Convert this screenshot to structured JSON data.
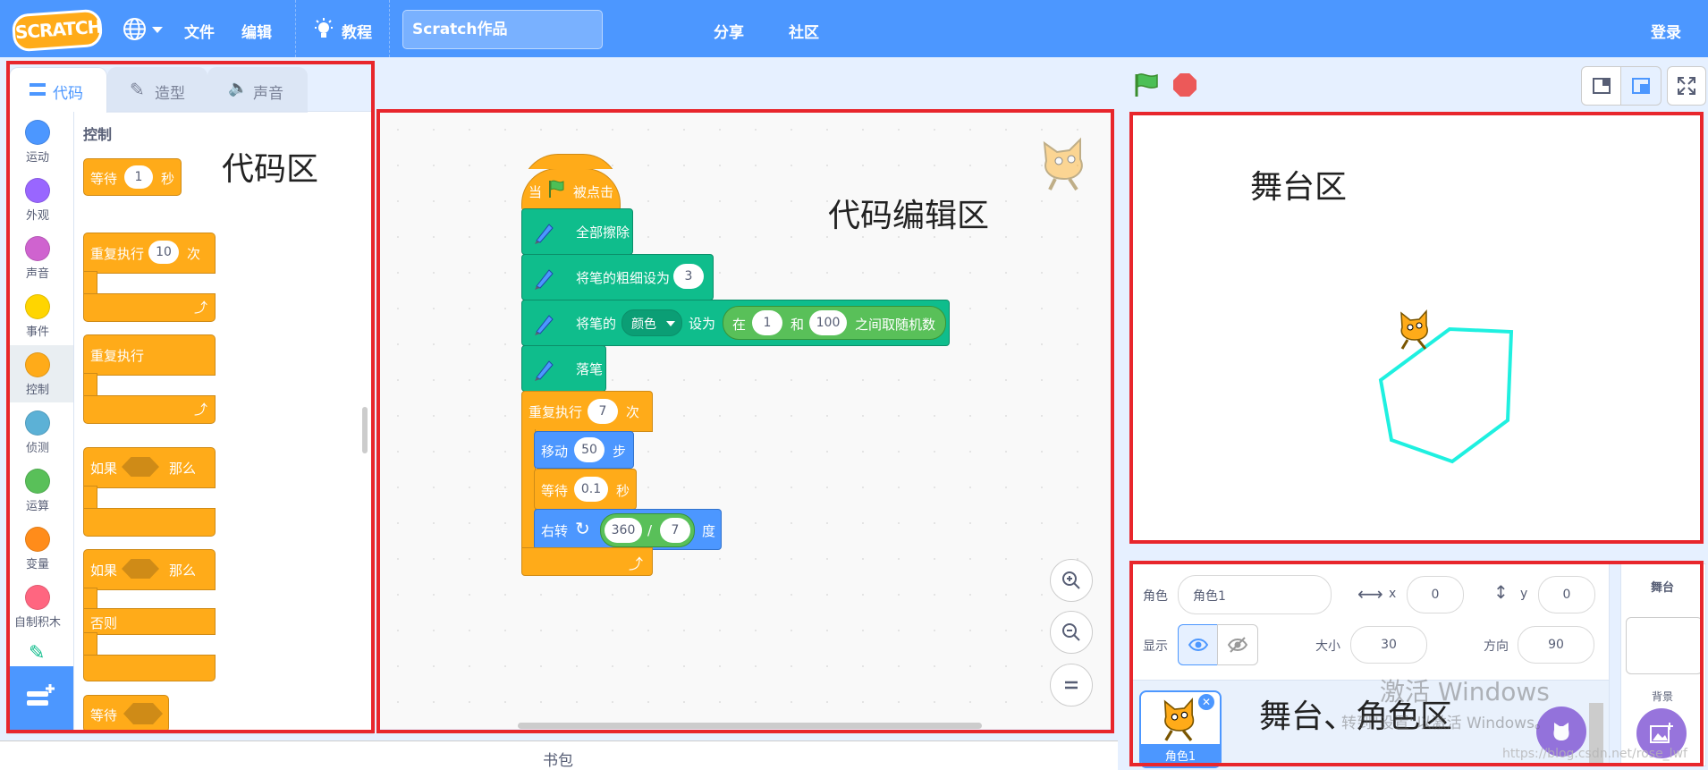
{
  "menu": {
    "logo": "SCRATCH",
    "file": "文件",
    "edit": "编辑",
    "tutorials": "教程",
    "project_title": "Scratch作品",
    "share": "分享",
    "community": "社区",
    "login": "登录"
  },
  "tabs": {
    "code": "代码",
    "costumes": "造型",
    "sounds": "声音"
  },
  "categories": [
    {
      "label": "运动",
      "color": "#4c97ff"
    },
    {
      "label": "外观",
      "color": "#9966ff"
    },
    {
      "label": "声音",
      "color": "#cf63cf"
    },
    {
      "label": "事件",
      "color": "#ffd500"
    },
    {
      "label": "控制",
      "color": "#ffab19"
    },
    {
      "label": "侦测",
      "color": "#5cb1d6"
    },
    {
      "label": "运算",
      "color": "#59c059"
    },
    {
      "label": "变量",
      "color": "#ff8c1a"
    },
    {
      "label": "自制积木",
      "color": "#ff6680"
    }
  ],
  "palette": {
    "heading": "控制",
    "wait": "等待",
    "wait_value": "1",
    "wait_unit": "秒",
    "repeat": "重复执行",
    "repeat_value": "10",
    "repeat_unit": "次",
    "forever": "重复执行",
    "if": "如果",
    "then": "那么",
    "if2": "如果",
    "then2": "那么",
    "else": "否则",
    "wait_until": "等待"
  },
  "annotations": {
    "code_area": "代码区",
    "editor_area": "代码编辑区",
    "stage_area": "舞台区",
    "sprite_area": "舞台、角色区"
  },
  "script": {
    "hat_prefix": "当",
    "hat_suffix": "被点击",
    "clear": "全部擦除",
    "set_size": "将笔的粗细设为",
    "size_value": "3",
    "set_color_pre": "将笔的",
    "color_menu": "颜色",
    "set_color_mid": "设为",
    "rand_pre": "在",
    "rand_from": "1",
    "rand_and": "和",
    "rand_to": "100",
    "rand_post": "之间取随机数",
    "pen_down": "落笔",
    "repeat": "重复执行",
    "repeat_value": "7",
    "repeat_unit": "次",
    "move": "移动",
    "move_value": "50",
    "move_unit": "步",
    "wait": "等待",
    "wait_value": "0.1",
    "wait_unit": "秒",
    "turn": "右转",
    "turn_a": "360",
    "turn_op": "/",
    "turn_b": "7",
    "turn_unit": "度"
  },
  "sprite_info": {
    "sprite_label": "角色",
    "sprite_name": "角色1",
    "x_label": "x",
    "x_value": "0",
    "y_label": "y",
    "y_value": "0",
    "show_label": "显示",
    "size_label": "大小",
    "size_value": "30",
    "direction_label": "方向",
    "direction_value": "90"
  },
  "sprite_list": [
    {
      "name": "角色1"
    }
  ],
  "stage_panel": {
    "title": "舞台",
    "backdrop": "背景"
  },
  "backpack": "书包",
  "watermark": {
    "line1": "激活 Windows",
    "line2": "转到\"设置\"以激活 Windows。",
    "url": "https://blog.csdn.net/rose_lwf"
  }
}
